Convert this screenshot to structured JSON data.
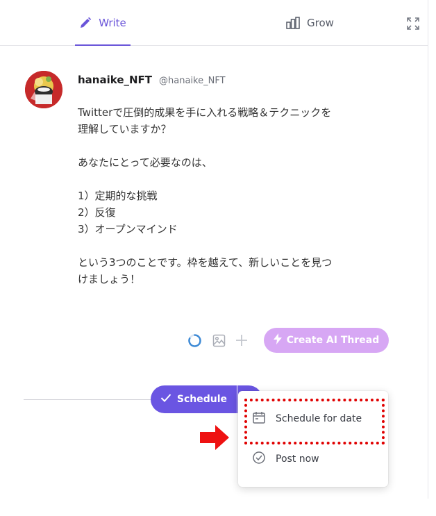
{
  "tabs": {
    "write": {
      "label": "Write"
    },
    "grow": {
      "label": "Grow"
    }
  },
  "post": {
    "display_name": "hanaike_NFT",
    "handle": "@hanaike_NFT",
    "paragraphs": [
      "Twitterで圧倒的成果を手に入れる戦略＆テクニックを\n理解していますか？",
      "あなたにとって必要なのは、",
      "1）定期的な挑戦\n2）反復\n3）オープンマインド",
      "という3つのことです。枠を越えて、新しいことを見つ\nけましょう！"
    ]
  },
  "composer": {
    "ai_button_label": "Create AI Thread"
  },
  "schedule": {
    "button_label": "Schedule"
  },
  "dropdown": {
    "items": [
      {
        "label": "Schedule for date",
        "icon": "calendar-icon"
      },
      {
        "label": "Post now",
        "icon": "check-circle-icon"
      }
    ]
  },
  "colors": {
    "accent": "#6a55d9",
    "schedule_button": "#6a55e2",
    "ai_button": "#d7a7f4",
    "highlight": "#e00000"
  }
}
